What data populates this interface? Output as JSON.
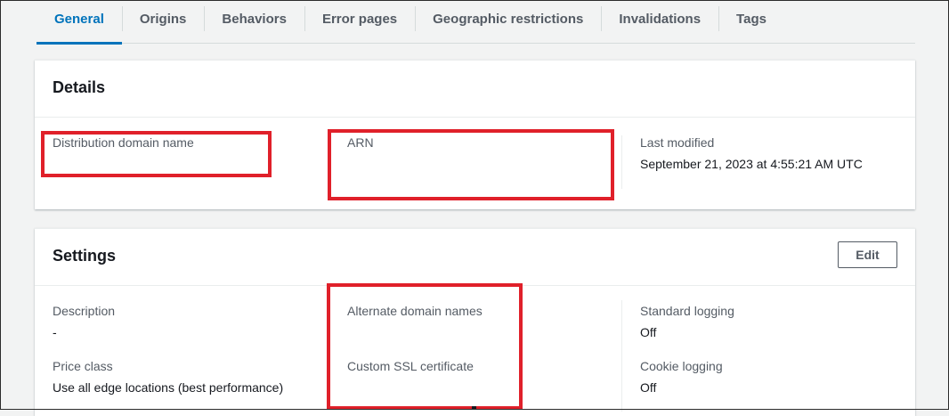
{
  "tabs": [
    {
      "label": "General",
      "active": true
    },
    {
      "label": "Origins"
    },
    {
      "label": "Behaviors"
    },
    {
      "label": "Error pages"
    },
    {
      "label": "Geographic restrictions"
    },
    {
      "label": "Invalidations"
    },
    {
      "label": "Tags"
    }
  ],
  "details": {
    "title": "Details",
    "distribution_domain_label": "Distribution domain name",
    "arn_label": "ARN",
    "last_modified_label": "Last modified",
    "last_modified_value": "September 21, 2023 at 4:55:21 AM UTC"
  },
  "settings": {
    "title": "Settings",
    "edit_label": "Edit",
    "description_label": "Description",
    "description_value": "-",
    "price_class_label": "Price class",
    "price_class_value": "Use all edge locations (best performance)",
    "alternate_domains_label": "Alternate domain names",
    "ssl_label": "Custom SSL certificate",
    "standard_logging_label": "Standard logging",
    "standard_logging_value": "Off",
    "cookie_logging_label": "Cookie logging",
    "cookie_logging_value": "Off"
  },
  "colors": {
    "accent": "#0073bb",
    "highlight": "#e0202a"
  }
}
